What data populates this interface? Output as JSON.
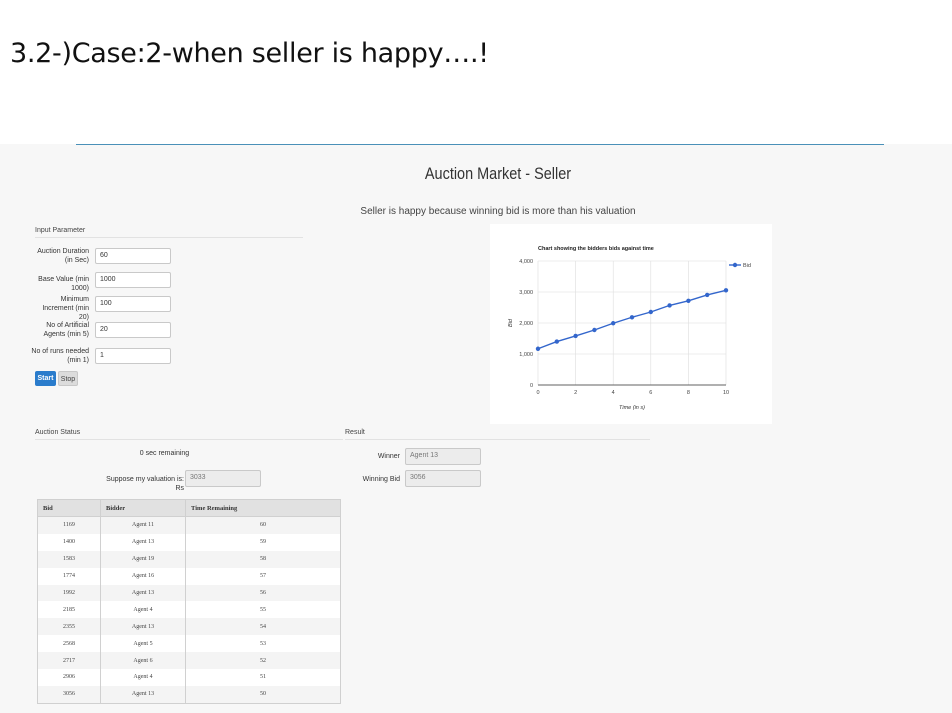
{
  "slide": {
    "title": "3.2-)Case:2-when seller is happy….!"
  },
  "app": {
    "title": "Auction Market - Seller",
    "message": "Seller is happy because winning bid is more than his valuation"
  },
  "input_parameter": {
    "heading": "Input Parameter",
    "fields": [
      {
        "label": "Auction Duration (in Sec)",
        "value": "60"
      },
      {
        "label": "Base Value (min 1000)",
        "value": "1000"
      },
      {
        "label": "Minimum Increment (min 20)",
        "value": "100"
      },
      {
        "label": "No of Artificial Agents (min 5)",
        "value": "20"
      },
      {
        "label": "No of runs needed (min 1)",
        "value": "1"
      }
    ],
    "start_label": "Start",
    "stop_label": "Stop"
  },
  "auction_status": {
    "heading": "Auction Status",
    "remaining": "0 sec remaining",
    "valuation_label": "Suppose my valuation is: Rs",
    "valuation_value": "3033"
  },
  "result": {
    "heading": "Result",
    "winner_label": "Winner",
    "winner_value": "Agent 13",
    "winning_bid_label": "Winning Bid",
    "winning_bid_value": "3056"
  },
  "bid_table": {
    "headers": [
      "Bid",
      "Bidder",
      "Time Remaining"
    ],
    "rows": [
      [
        "1169",
        "Agent 11",
        "60"
      ],
      [
        "1400",
        "Agent 13",
        "59"
      ],
      [
        "1583",
        "Agent 19",
        "58"
      ],
      [
        "1774",
        "Agent 16",
        "57"
      ],
      [
        "1992",
        "Agent 13",
        "56"
      ],
      [
        "2185",
        "Agent 4",
        "55"
      ],
      [
        "2355",
        "Agent 13",
        "54"
      ],
      [
        "2568",
        "Agent 5",
        "53"
      ],
      [
        "2717",
        "Agent 6",
        "52"
      ],
      [
        "2906",
        "Agent 4",
        "51"
      ],
      [
        "3056",
        "Agent 13",
        "50"
      ]
    ]
  },
  "chart_data": {
    "type": "line",
    "title": "Chart showing the bidders bids against time",
    "xlabel": "Time (in s)",
    "ylabel": "Bid",
    "xlim": [
      0,
      10
    ],
    "ylim": [
      0,
      4000
    ],
    "xticks": [
      0,
      2,
      4,
      6,
      8,
      10
    ],
    "yticks": [
      0,
      1000,
      2000,
      3000,
      4000
    ],
    "ytick_labels": [
      "0",
      "1,000",
      "2,000",
      "3,000",
      "4,000"
    ],
    "grid": true,
    "legend": "top-right",
    "color": "#3366cc",
    "series": [
      {
        "name": "Bid",
        "x": [
          0,
          1,
          2,
          3,
          4,
          5,
          6,
          7,
          8,
          9,
          10
        ],
        "y": [
          1169,
          1400,
          1583,
          1774,
          1992,
          2185,
          2355,
          2568,
          2717,
          2906,
          3056
        ]
      }
    ]
  }
}
